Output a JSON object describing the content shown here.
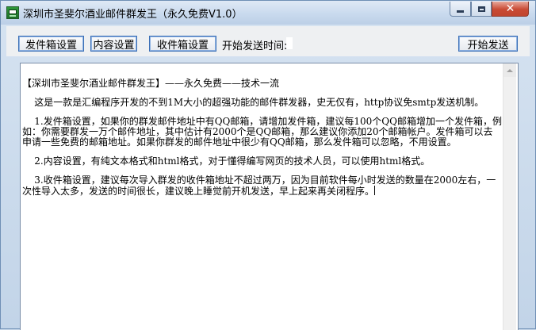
{
  "window": {
    "title": "深圳市圣斐尔酒业邮件群发王（永久免费V1.0）",
    "app_icon": "mail-app-icon",
    "controls": {
      "minimize_icon": "minimize-icon",
      "maximize_icon": "maximize-icon",
      "close_icon": "close-icon",
      "close_glyph": "✕"
    },
    "close_color": "#c94a34"
  },
  "toolbar": {
    "sender_settings_label": "发件箱设置",
    "content_settings_label": "内容设置",
    "receiver_settings_label": "收件箱设置",
    "start_time_label": "开始发送时间:",
    "start_time_value": "",
    "start_send_label": "开始发送",
    "button_border_color": "#3b6fb6"
  },
  "editor": {
    "paragraphs": [
      "【深圳市圣斐尔酒业邮件群发王】——永久免费——技术一流",
      "    这是一款是汇编程序开发的不到1M大小的超强功能的邮件群发器，史无仅有，http协议免smtp发送机制。",
      "    1.发件箱设置，如果你的群发邮件地址中有QQ邮箱，请增加发件箱，建议每100个QQ邮箱增加一个发件箱，例如：你需要群发一万个邮件地址，其中估计有2000个是QQ邮箱，那么建议你添加20个邮箱帐户。发件箱可以去申请一些免费的邮箱地址。如果你群发的邮件地址中很少有QQ邮箱，那么发件箱可以忽略，不用设置。",
      "    2.内容设置，有纯文本格式和html格式，对于懂得编写网页的技术人员，可以使用html格式。",
      "    3.收件箱设置，建议每次导入群发的收件箱地址不超过两万，因为目前软件每小时发送的数量在2000左右，一次性导入太多，发送的时间很长，建议晚上睡觉前开机发送，早上起来再关闭程序。"
    ]
  },
  "scrollbar": {
    "up_arrow_icon": "scroll-up-arrow-icon"
  }
}
